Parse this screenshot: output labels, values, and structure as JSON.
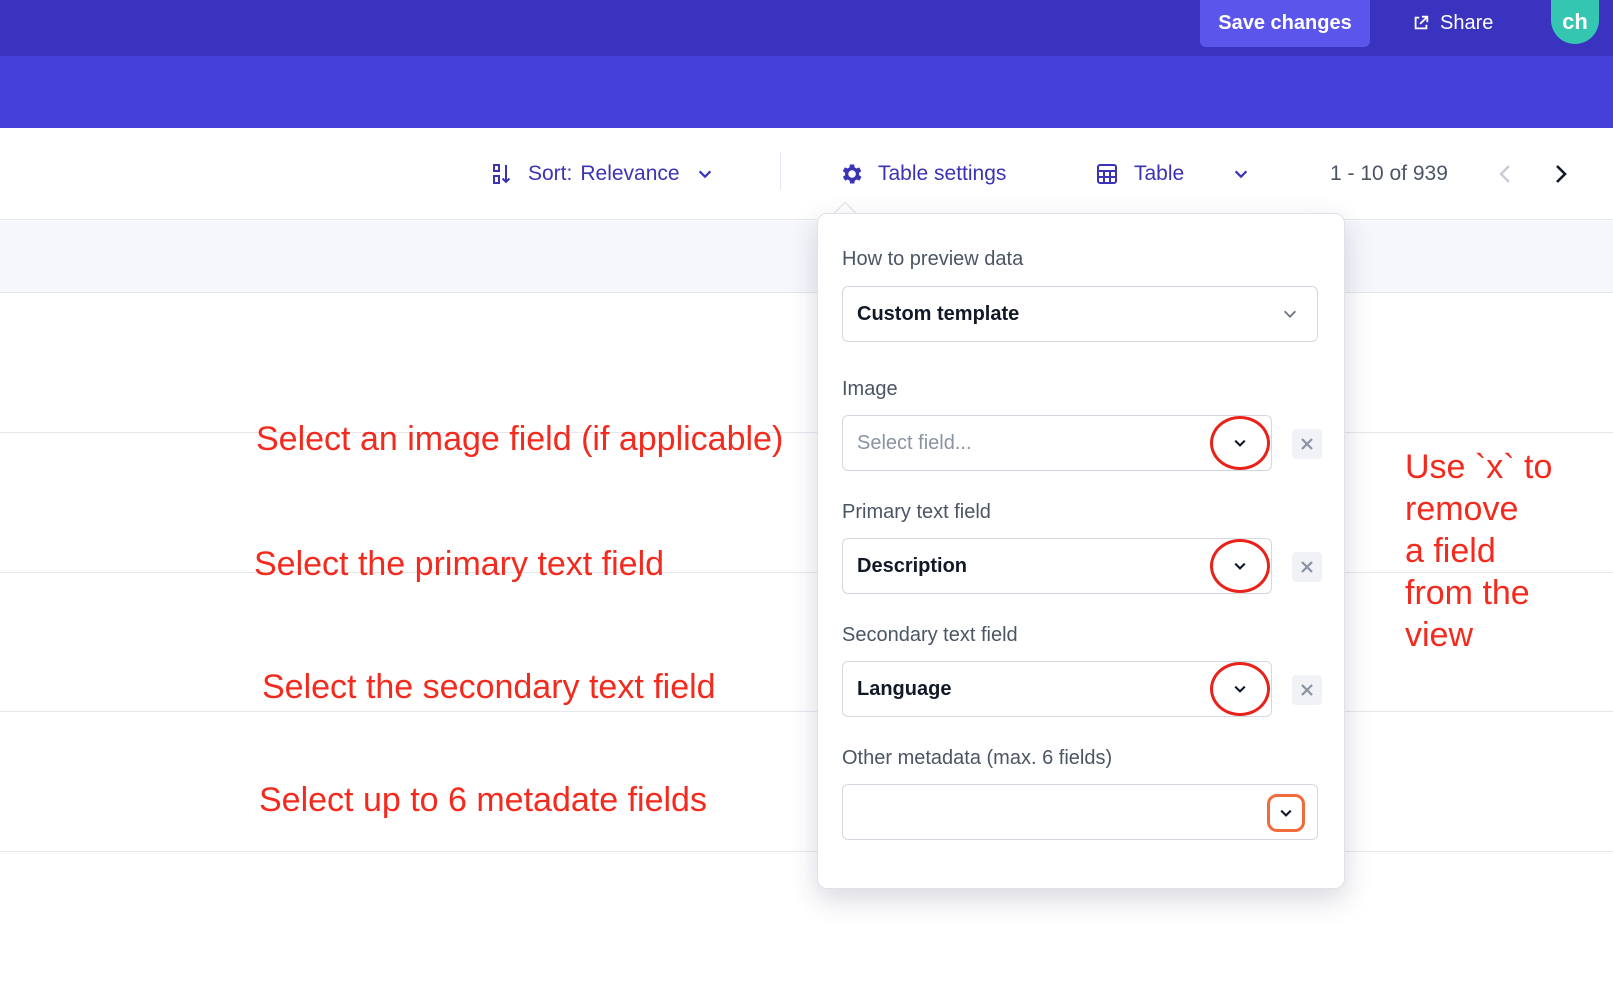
{
  "header": {
    "save_label": "Save changes",
    "share_label": "Share",
    "avatar_initials": "ch",
    "colors": {
      "topbar": "#3a33c0",
      "band": "#4640db",
      "avatar": "#34c6b1"
    }
  },
  "toolbar": {
    "sort_prefix": "Sort:",
    "sort_value": "Relevance",
    "table_settings_label": "Table settings",
    "view_label": "Table",
    "pagination_text": "1 - 10 of 939"
  },
  "popover": {
    "preview_label": "How to preview data",
    "preview_value": "Custom template",
    "image_label": "Image",
    "image_placeholder": "Select field...",
    "primary_label": "Primary text field",
    "primary_value": "Description",
    "secondary_label": "Secondary text field",
    "secondary_value": "Language",
    "metadata_label": "Other metadata (max. 6 fields)",
    "metadata_value": ""
  },
  "annotations": {
    "image": "Select an image field (if applicable)",
    "primary": "Select the primary text field",
    "secondary": "Select the secondary text field",
    "metadata": "Select up to 6 metadate fields",
    "remove_lines": [
      "Use `x` to",
      "remove",
      "a field",
      "from the",
      "view"
    ],
    "color": "#f32b1f"
  }
}
